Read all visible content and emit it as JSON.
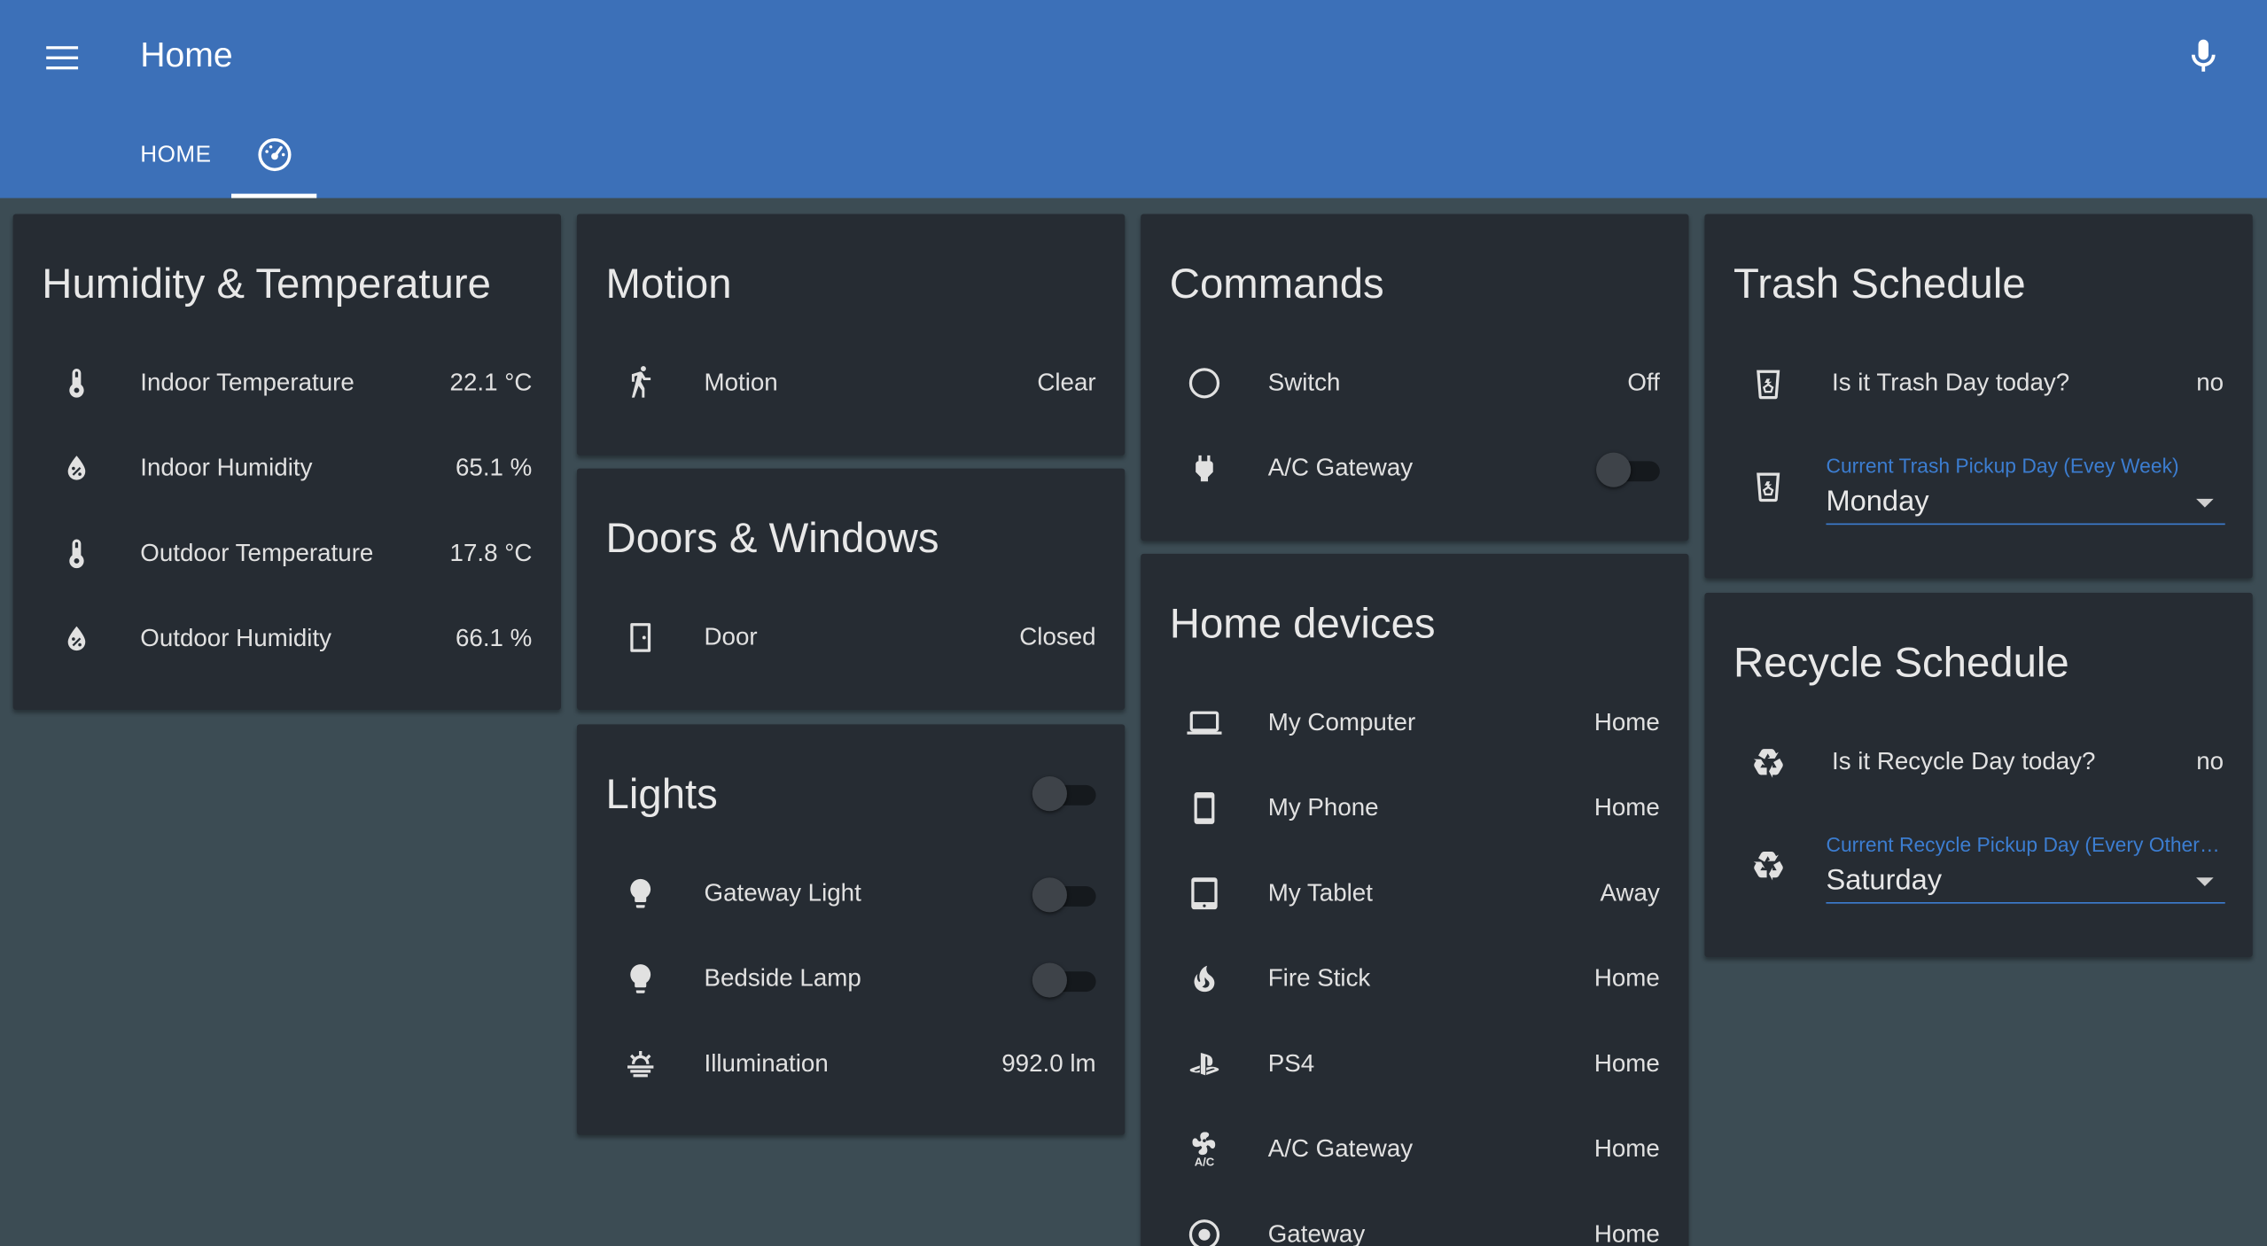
{
  "header": {
    "title": "Home",
    "tabs": [
      {
        "label": "HOME",
        "icon": "home-tab"
      },
      {
        "label": "",
        "icon": "speedometer-icon"
      }
    ],
    "background": "#3c70b8"
  },
  "cards": {
    "humidity_temperature": {
      "title": "Humidity & Temperature",
      "rows": [
        {
          "label": "Indoor Temperature",
          "value": "22.1 °C",
          "icon": "thermometer-icon"
        },
        {
          "label": "Indoor Humidity",
          "value": "65.1 %",
          "icon": "water-percent-icon"
        },
        {
          "label": "Outdoor Temperature",
          "value": "17.8 °C",
          "icon": "thermometer-icon"
        },
        {
          "label": "Outdoor Humidity",
          "value": "66.1 %",
          "icon": "water-percent-icon"
        }
      ]
    },
    "motion": {
      "title": "Motion",
      "rows": [
        {
          "label": "Motion",
          "value": "Clear",
          "icon": "walk-icon"
        }
      ]
    },
    "doors_windows": {
      "title": "Doors & Windows",
      "rows": [
        {
          "label": "Door",
          "value": "Closed",
          "icon": "door-icon"
        }
      ]
    },
    "lights": {
      "title": "Lights",
      "rows": [
        {
          "label": "Gateway Light",
          "icon": "lightbulb-icon",
          "state": "off"
        },
        {
          "label": "Bedside Lamp",
          "icon": "lightbulb-icon",
          "state": "off"
        },
        {
          "label": "Illumination",
          "value": "992.0 lm",
          "icon": "illumination-icon"
        }
      ]
    },
    "commands": {
      "title": "Commands",
      "rows": [
        {
          "label": "Switch",
          "value": "Off",
          "icon": "circle-outline-icon"
        },
        {
          "label": "A/C Gateway",
          "icon": "power-plug-icon",
          "state": "off"
        }
      ]
    },
    "home_devices": {
      "title": "Home devices",
      "rows": [
        {
          "label": "My Computer",
          "value": "Home",
          "icon": "laptop-icon"
        },
        {
          "label": "My Phone",
          "value": "Home",
          "icon": "cellphone-icon"
        },
        {
          "label": "My Tablet",
          "value": "Away",
          "icon": "tablet-icon"
        },
        {
          "label": "Fire Stick",
          "value": "Home",
          "icon": "fire-icon"
        },
        {
          "label": "PS4",
          "value": "Home",
          "icon": "playstation-icon"
        },
        {
          "label": "A/C Gateway",
          "value": "Home",
          "icon": "air-conditioner-icon"
        },
        {
          "label": "Gateway",
          "value": "Home",
          "icon": "radiobox-marked-icon"
        }
      ]
    },
    "trash_schedule": {
      "title": "Trash Schedule",
      "question_label": "Is it Trash Day today?",
      "question_value": "no",
      "select_label": "Current Trash Pickup Day (Evey Week)",
      "select_value": "Monday"
    },
    "recycle_schedule": {
      "title": "Recycle Schedule",
      "question_label": "Is it Recycle Day today?",
      "question_value": "no",
      "select_label": "Current Recycle Pickup Day (Every Other Week)",
      "select_value": "Saturday"
    }
  },
  "colors": {
    "page_background": "#3c4c54",
    "card_background": "#262c33",
    "accent": "#3c7dd0"
  }
}
